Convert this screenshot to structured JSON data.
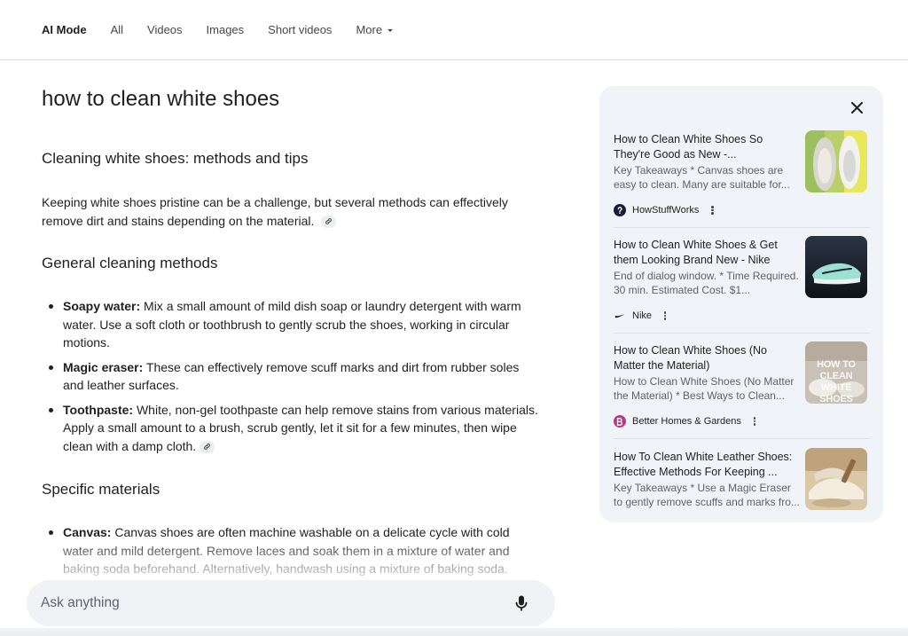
{
  "nav": {
    "tabs": [
      {
        "label": "AI Mode",
        "active": true
      },
      {
        "label": "All",
        "active": false
      },
      {
        "label": "Videos",
        "active": false
      },
      {
        "label": "Images",
        "active": false
      },
      {
        "label": "Short videos",
        "active": false
      },
      {
        "label": "More",
        "active": false
      }
    ]
  },
  "main": {
    "query": "how to clean white shoes",
    "heading": "Cleaning white shoes: methods and tips",
    "intro": "Keeping white shoes pristine can be a challenge, but several methods can effectively remove dirt and stains depending on the material.",
    "general": {
      "heading": "General cleaning methods",
      "items": [
        {
          "term": "Soapy water:",
          "text": " Mix a small amount of mild dish soap or laundry detergent with warm water. Use a soft cloth or toothbrush to gently scrub the shoes, working in circular motions."
        },
        {
          "term": "Magic eraser:",
          "text": " These can effectively remove scuff marks and dirt from rubber soles and leather surfaces."
        },
        {
          "term": "Toothpaste:",
          "text": " White, non-gel toothpaste can help remove stains from various materials. Apply a small amount to a brush, scrub gently, let it sit for a few minutes, then wipe clean with a damp cloth."
        }
      ]
    },
    "specific": {
      "heading": "Specific materials",
      "items": [
        {
          "term": "Canvas:",
          "text": " Canvas shoes are often machine washable on a delicate cycle with cold water and mild detergent. Remove laces and soak them in a mixture of water and baking soda beforehand. Alternatively, handwash using a mixture of baking soda."
        }
      ]
    }
  },
  "ask": {
    "placeholder": "Ask anything"
  },
  "sources": [
    {
      "title": "How to Clean White Shoes So They're Good as New -...",
      "snippet": "Key Takeaways * Canvas shoes are easy to clean. Many are suitable for...",
      "site": "HowStuffWorks"
    },
    {
      "title": "How to Clean White Shoes & Get them Looking Brand New - Nike",
      "snippet": "End of dialog window. * Time Required. 30 min. Estimated Cost. $1...",
      "site": "Nike"
    },
    {
      "title": "How to Clean White Shoes (No Matter the Material)",
      "snippet": "How to Clean White Shoes (No Matter the Material) * Best Ways to Clean...",
      "site": "Better Homes & Gardens",
      "thumb_text": "HOW TO CLEAN WHITE SHOES"
    },
    {
      "title": "How To Clean White Leather Shoes: Effective Methods For Keeping ...",
      "snippet": "Key Takeaways * Use a Magic Eraser to gently remove scuffs and marks fro..."
    }
  ],
  "colors": {
    "panel_bg": "#f0f3f7",
    "ask_bg": "#f0f2f5",
    "bhg_favicon": "#b03a8c"
  }
}
